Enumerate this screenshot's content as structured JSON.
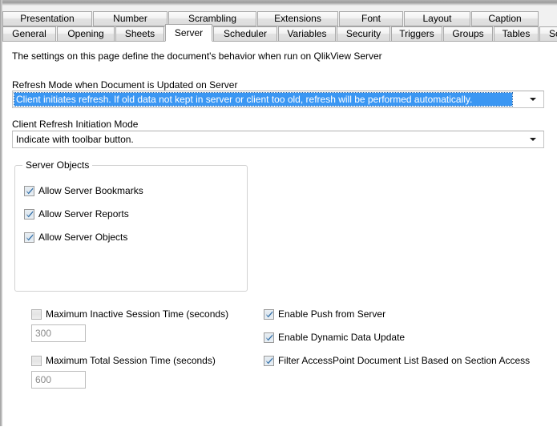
{
  "tabs": {
    "top_row": [
      {
        "label": "Presentation",
        "width": 112,
        "selected": false
      },
      {
        "label": "Number",
        "width": 93,
        "selected": false
      },
      {
        "label": "Scrambling",
        "width": 110,
        "selected": false
      },
      {
        "label": "Extensions",
        "width": 101,
        "selected": false
      },
      {
        "label": "Font",
        "width": 80,
        "selected": false
      },
      {
        "label": "Layout",
        "width": 83,
        "selected": false
      },
      {
        "label": "Caption",
        "width": 84,
        "selected": false
      }
    ],
    "bottom_row": [
      {
        "label": "General",
        "width": 67,
        "selected": false
      },
      {
        "label": "Opening",
        "width": 72,
        "selected": false
      },
      {
        "label": "Sheets",
        "width": 61,
        "selected": false
      },
      {
        "label": "Server",
        "width": 59,
        "selected": true
      },
      {
        "label": "Scheduler",
        "width": 80,
        "selected": false
      },
      {
        "label": "Variables",
        "width": 72,
        "selected": false
      },
      {
        "label": "Security",
        "width": 67,
        "selected": false
      },
      {
        "label": "Triggers",
        "width": 64,
        "selected": false
      },
      {
        "label": "Groups",
        "width": 62,
        "selected": false
      },
      {
        "label": "Tables",
        "width": 56,
        "selected": false
      },
      {
        "label": "Sort",
        "width": 46,
        "selected": false
      }
    ]
  },
  "page": {
    "intro_text": "The settings on this page define the document's behavior when run on QlikView Server",
    "refresh_mode": {
      "label": "Refresh Mode when Document is Updated on Server",
      "value": "Client initiates refresh. If old data not kept in server or client too old, refresh will be performed automatically.",
      "highlighted": true,
      "arrow_icon": "chevron-down-icon"
    },
    "client_refresh": {
      "label": "Client Refresh Initiation Mode",
      "value": "Indicate with toolbar button.",
      "arrow_icon": "chevron-down-icon"
    },
    "server_objects": {
      "title": "Server Objects",
      "items": [
        {
          "label": "Allow Server Bookmarks",
          "checked": true
        },
        {
          "label": "Allow Server Reports",
          "checked": true
        },
        {
          "label": "Allow Server Objects",
          "checked": true
        }
      ]
    },
    "session_limits": [
      {
        "label": "Maximum Inactive Session Time (seconds)",
        "checked": false,
        "value": "300"
      },
      {
        "label": "Maximum Total Session Time (seconds)",
        "checked": false,
        "value": "600"
      }
    ],
    "server_features": [
      {
        "label": "Enable Push from Server",
        "checked": true
      },
      {
        "label": "Enable Dynamic Data Update",
        "checked": true
      },
      {
        "label": "Filter AccessPoint Document List Based on Section Access",
        "checked": true
      }
    ]
  },
  "colors": {
    "selection_blue": "#3b97f3",
    "tab_face": "#e9e9e9",
    "page_background": "#ffffff",
    "group_border": "#d2d2d2"
  }
}
